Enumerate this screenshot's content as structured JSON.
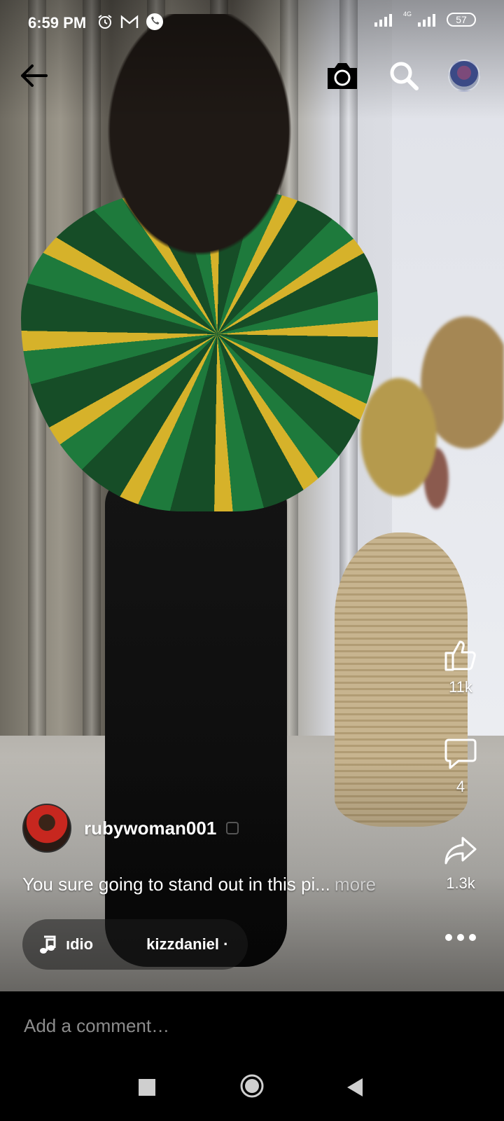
{
  "status_bar": {
    "time": "6:59 PM",
    "left_icons": [
      "alarm-icon",
      "gmail-icon",
      "phone-call-icon"
    ],
    "network_label": "4G",
    "battery": "57"
  },
  "top_bar": {
    "icons": [
      "back-arrow-icon",
      "camera-icon",
      "search-icon",
      "profile-avatar"
    ]
  },
  "actions": {
    "likes": "11k",
    "comments": "4",
    "shares": "1.3k"
  },
  "post": {
    "author": "rubywoman001",
    "caption": "You sure going to stand out in this pi...",
    "more_label": "more",
    "audio_title": "ıdio",
    "audio_artist": "kizzdaniel ·"
  },
  "comment": {
    "placeholder": "Add a comment…"
  },
  "colors": {
    "background": "#000000",
    "text": "#ffffff",
    "muted": "#8c8c8c"
  }
}
